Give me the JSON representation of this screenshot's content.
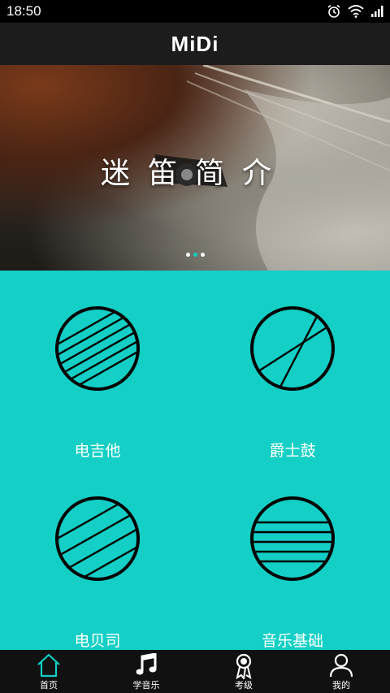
{
  "status_bar": {
    "time": "18:50",
    "icons": [
      "alarm-icon",
      "wifi-icon",
      "signal-icon"
    ]
  },
  "app_bar": {
    "logo_text": "MiDi"
  },
  "banner": {
    "title": "迷笛简介",
    "page_count": 3,
    "active_page": 2
  },
  "categories": [
    {
      "label": "电吉他",
      "icon": "electric-guitar-icon"
    },
    {
      "label": "爵士鼓",
      "icon": "jazz-drum-icon"
    },
    {
      "label": "电贝司",
      "icon": "electric-bass-icon"
    },
    {
      "label": "音乐基础",
      "icon": "music-basics-icon"
    }
  ],
  "bottom_nav": {
    "items": [
      {
        "label": "首页",
        "icon": "home-icon",
        "active": true
      },
      {
        "label": "学音乐",
        "icon": "music-note-icon",
        "active": false
      },
      {
        "label": "考级",
        "icon": "award-icon",
        "active": false
      },
      {
        "label": "我的",
        "icon": "profile-icon",
        "active": false
      }
    ]
  },
  "colors": {
    "accent": "#13cfc5",
    "app_bar": "#1c1c1c",
    "bottom_nav": "#111111"
  }
}
